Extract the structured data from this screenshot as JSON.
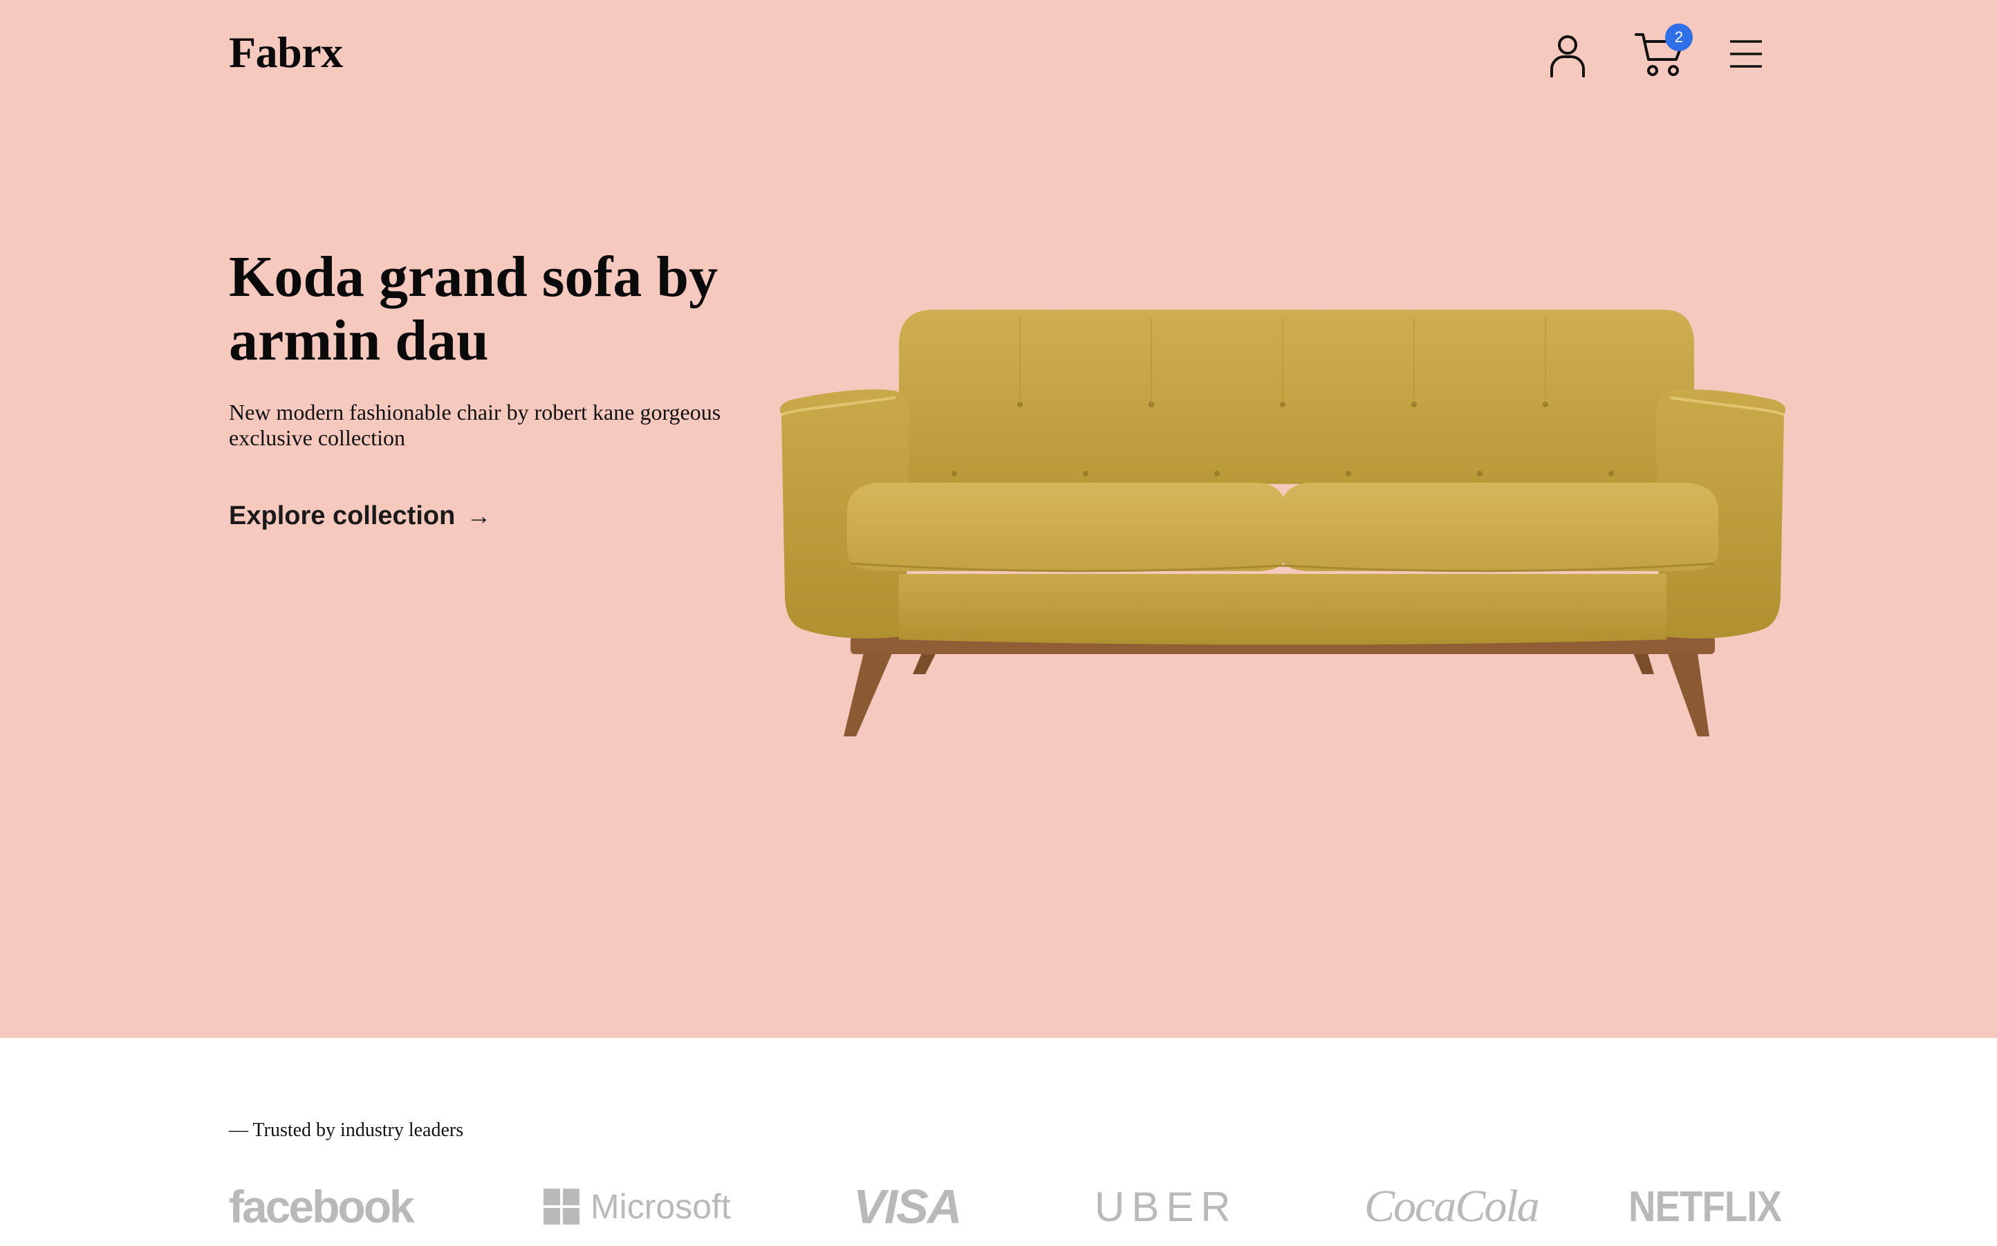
{
  "header": {
    "logo": "Fabrx",
    "cart_count": "2",
    "icons": [
      "user-icon",
      "cart-icon",
      "menu-icon"
    ]
  },
  "hero": {
    "background": "#f6c9bf",
    "title": "Koda grand sofa by armin dau",
    "subtitle": "New modern fashionable chair by robert kane gorgeous exclusive collection",
    "cta_label": "Explore collection",
    "cta_arrow": "→",
    "image": "mustard-sofa-image"
  },
  "trusted": {
    "label": "— Trusted by industry leaders",
    "brands": [
      "facebook",
      "Microsoft",
      "VISA",
      "UBER",
      "CocaCola",
      "NETFLIX"
    ]
  },
  "colors": {
    "accent_badge": "#2f6fe8",
    "hero_bg": "#f6c9bf",
    "sofa": "#c7a64a",
    "brand_gray": "#b9b9b9"
  }
}
